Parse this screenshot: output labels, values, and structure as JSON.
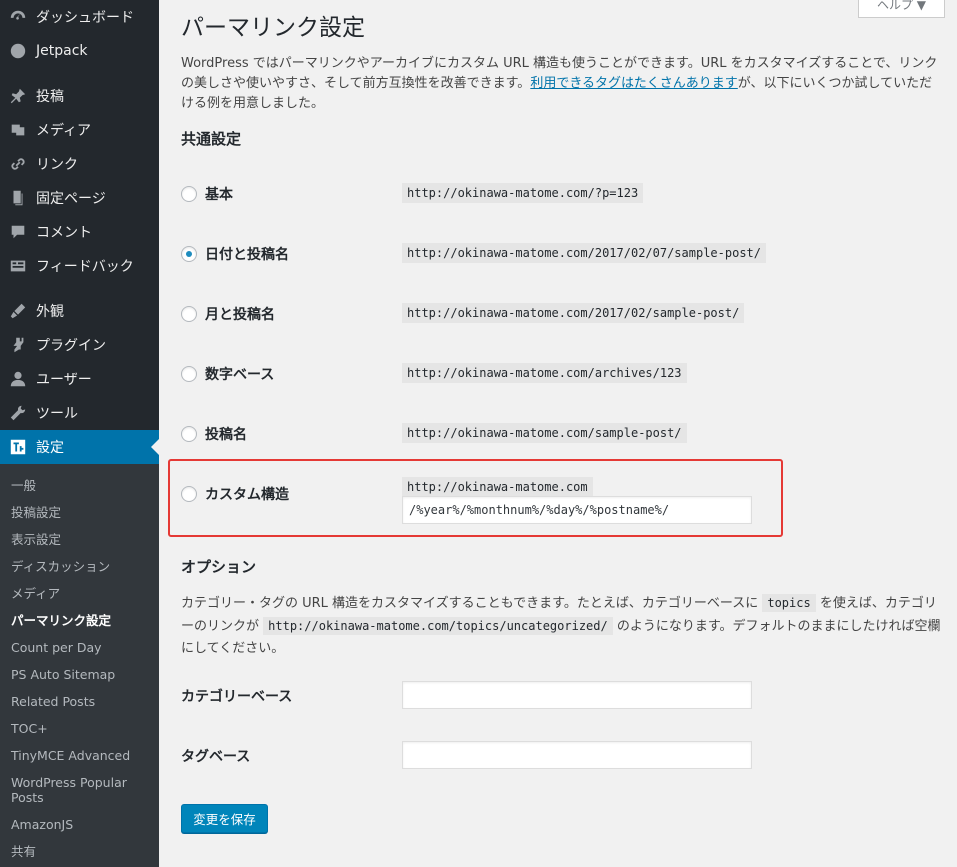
{
  "sidebar": {
    "items": [
      {
        "label": "ダッシュボード",
        "icon": "dashboard-icon"
      },
      {
        "label": "Jetpack",
        "icon": "jetpack-icon"
      },
      {
        "label": "投稿",
        "icon": "pin-icon"
      },
      {
        "label": "メディア",
        "icon": "media-icon"
      },
      {
        "label": "リンク",
        "icon": "link-icon"
      },
      {
        "label": "固定ページ",
        "icon": "page-icon"
      },
      {
        "label": "コメント",
        "icon": "comment-icon"
      },
      {
        "label": "フィードバック",
        "icon": "feedback-icon"
      },
      {
        "label": "外観",
        "icon": "appearance-icon"
      },
      {
        "label": "プラグイン",
        "icon": "plugin-icon"
      },
      {
        "label": "ユーザー",
        "icon": "user-icon"
      },
      {
        "label": "ツール",
        "icon": "wrench-icon"
      },
      {
        "label": "設定",
        "icon": "settings-icon"
      }
    ],
    "submenu": [
      "一般",
      "投稿設定",
      "表示設定",
      "ディスカッション",
      "メディア",
      "パーマリンク設定",
      "Count per Day",
      "PS Auto Sitemap",
      "Related Posts",
      "TOC+",
      "TinyMCE Advanced",
      "WordPress Popular Posts",
      "AmazonJS",
      "共有"
    ]
  },
  "help_tab": "ヘルプ ▼",
  "page_title": "パーマリンク設定",
  "intro": {
    "before": "WordPress ではパーマリンクやアーカイブにカスタム URL 構造も使うことができます。URL をカスタマイズすることで、リンクの美しさや使いやすさ、そして前方互換性を改善できます。",
    "link": "利用できるタグはたくさんあります",
    "after": "が、以下にいくつか試していただける例を用意しました。"
  },
  "common_settings": {
    "title": "共通設定",
    "options": [
      {
        "label": "基本",
        "example": "http://okinawa-matome.com/?p=123",
        "checked": false
      },
      {
        "label": "日付と投稿名",
        "example": "http://okinawa-matome.com/2017/02/07/sample-post/",
        "checked": true
      },
      {
        "label": "月と投稿名",
        "example": "http://okinawa-matome.com/2017/02/sample-post/",
        "checked": false
      },
      {
        "label": "数字ベース",
        "example": "http://okinawa-matome.com/archives/123",
        "checked": false
      },
      {
        "label": "投稿名",
        "example": "http://okinawa-matome.com/sample-post/",
        "checked": false
      },
      {
        "label": "カスタム構造",
        "example": "http://okinawa-matome.com",
        "checked": false
      }
    ],
    "custom_value": "/%year%/%monthnum%/%day%/%postname%/"
  },
  "optional": {
    "title": "オプション",
    "desc_1": "カテゴリー・タグの URL 構造をカスタマイズすることもできます。たとえば、カテゴリーベースに",
    "code_1": "topics",
    "desc_2": "を使えば、カテゴリーのリンクが",
    "code_2": "http://okinawa-matome.com/topics/uncategorized/",
    "desc_3": "のようになります。デフォルトのままにしたければ空欄にしてください。",
    "category_base_label": "カテゴリーベース",
    "category_base_value": "",
    "tag_base_label": "タグベース",
    "tag_base_value": ""
  },
  "save_label": "変更を保存",
  "colors": {
    "sidebar": "#23282d",
    "active": "#0073aa",
    "button": "#0085ba",
    "highlight": "#e53935"
  }
}
